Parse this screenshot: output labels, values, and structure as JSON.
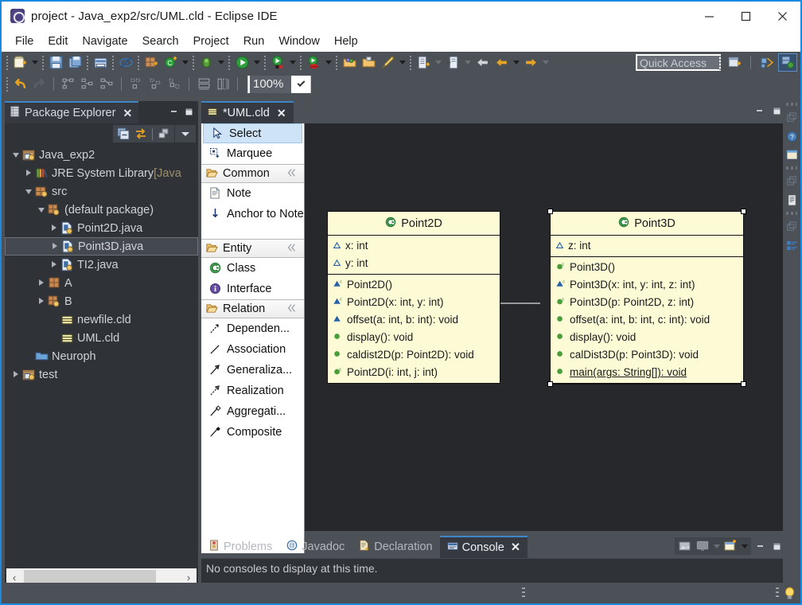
{
  "window": {
    "title": "project - Java_exp2/src/UML.cld - Eclipse IDE",
    "app_icon": "eclipse-icon",
    "minimize_label": "—",
    "maximize_label": "□",
    "close_label": "✕"
  },
  "menubar": {
    "items": [
      {
        "label": "File"
      },
      {
        "label": "Edit"
      },
      {
        "label": "Navigate"
      },
      {
        "label": "Search"
      },
      {
        "label": "Project"
      },
      {
        "label": "Run"
      },
      {
        "label": "Window"
      },
      {
        "label": "Help"
      }
    ]
  },
  "toolbar": {
    "zoom_value": "100%",
    "quick_access_placeholder": "Quick Access",
    "row1_icons": [
      "new-wizard-icon",
      "new-dropdown-arrow",
      "save-icon",
      "save-all-icon",
      "print-icon",
      "toggle-mark-occurrences-icon",
      "new-java-package-icon",
      "new-java-class-icon",
      "new-java-class-dropdown-arrow",
      "debug-icon",
      "debug-dropdown-arrow",
      "run-icon",
      "run-dropdown-arrow",
      "run-coverage-icon",
      "coverage-dropdown-arrow",
      "run-ant-icon",
      "ant-dropdown-arrow",
      "open-type-icon",
      "open-task-icon",
      "annotation-icon",
      "annotation-dropdown-arrow",
      "next-annotation-icon",
      "next-annotation-dropdown-arrow",
      "previous-edit-icon",
      "previous-edit-dropdown-arrow",
      "back-icon",
      "forward-orange-icon",
      "forward-dropdown-arrow",
      "next-icon",
      "next-dropdown-arrow"
    ],
    "row2_icons": [
      "undo-icon",
      "redo-icon",
      "align-left-icon",
      "align-center-icon",
      "align-right-icon",
      "align-top-icon",
      "align-middle-icon",
      "align-bottom-icon",
      "match-width-icon",
      "match-height-icon"
    ],
    "perspective_icons": [
      "open-perspective-icon",
      "java-perspective-icon",
      "uml-perspective-icon"
    ]
  },
  "package_explorer": {
    "tab_label": "Package Explorer",
    "tab_close": "✕",
    "tab_icon": "package-explorer-icon",
    "view_minimize": "—",
    "view_maximize": "■",
    "toolbar_icons": [
      "collapse-all-icon",
      "link-with-editor-icon",
      "focus-on-active-task-icon",
      "view-menu-icon"
    ],
    "tree": [
      {
        "label": "Java_exp2",
        "indent": 0,
        "twisty": "down",
        "icon": "java-project-icon",
        "selected": false
      },
      {
        "label": "JRE System Library",
        "indent": 1,
        "twisty": "right",
        "icon": "library-icon",
        "selected": false,
        "suffix": " [Java"
      },
      {
        "label": "src",
        "indent": 1,
        "twisty": "down",
        "icon": "source-folder-icon",
        "selected": false
      },
      {
        "label": "(default package)",
        "indent": 2,
        "twisty": "down",
        "icon": "package-icon",
        "selected": false
      },
      {
        "label": "Point2D.java",
        "indent": 3,
        "twisty": "right",
        "icon": "java-file-icon",
        "selected": false
      },
      {
        "label": "Point3D.java",
        "indent": 3,
        "twisty": "right",
        "icon": "java-file-icon",
        "selected": true
      },
      {
        "label": "TI2.java",
        "indent": 3,
        "twisty": "right",
        "icon": "java-file-icon",
        "selected": false
      },
      {
        "label": "A",
        "indent": 2,
        "twisty": "right",
        "icon": "package-plain-icon",
        "selected": false
      },
      {
        "label": "B",
        "indent": 2,
        "twisty": "right",
        "icon": "package-icon",
        "selected": false
      },
      {
        "label": "newfile.cld",
        "indent": 3,
        "twisty": "none",
        "icon": "cld-file-icon",
        "selected": false
      },
      {
        "label": "UML.cld",
        "indent": 3,
        "twisty": "none",
        "icon": "cld-file-icon",
        "selected": false
      },
      {
        "label": "Neuroph",
        "indent": 1,
        "twisty": "none",
        "icon": "folder-icon",
        "selected": false
      },
      {
        "label": "test",
        "indent": 0,
        "twisty": "right",
        "icon": "java-project-icon",
        "selected": false
      }
    ],
    "hscroll_left": "‹",
    "hscroll_right": "›"
  },
  "editor": {
    "tab_label": "*UML.cld",
    "tab_icon": "cld-file-icon",
    "tab_close": "✕",
    "minimize_label": "—",
    "maximize_label": "■"
  },
  "palette": {
    "tools": [
      {
        "label": "Select",
        "icon": "cursor-icon",
        "selected": true
      },
      {
        "label": "Marquee",
        "icon": "marquee-icon",
        "selected": false
      }
    ],
    "groups": [
      {
        "title": "Common",
        "icon": "folder-open-icon",
        "collapse_icon": "collapse-chevrons-icon",
        "items": [
          {
            "label": "Note",
            "icon": "note-icon",
            "two_line": false
          },
          {
            "label": "Anchor to Note",
            "icon": "anchor-arrow-icon",
            "two_line": true
          }
        ]
      },
      {
        "title": "Entity",
        "icon": "folder-open-icon",
        "collapse_icon": "collapse-chevrons-icon",
        "items": [
          {
            "label": "Class",
            "icon": "class-green-icon",
            "two_line": false
          },
          {
            "label": "Interface",
            "icon": "interface-purple-icon",
            "two_line": false
          }
        ]
      },
      {
        "title": "Relation",
        "icon": "folder-open-icon",
        "collapse_icon": "collapse-chevrons-icon",
        "items": [
          {
            "label": "Dependen...",
            "icon": "dependency-icon",
            "two_line": false
          },
          {
            "label": "Association",
            "icon": "association-icon",
            "two_line": false
          },
          {
            "label": "Generaliza...",
            "icon": "generalization-icon",
            "two_line": false
          },
          {
            "label": "Realization",
            "icon": "realization-icon",
            "two_line": false
          },
          {
            "label": "Aggregati...",
            "icon": "aggregation-icon",
            "two_line": false
          },
          {
            "label": "Composite",
            "icon": "composition-icon",
            "two_line": false
          }
        ]
      }
    ]
  },
  "diagram": {
    "classes": [
      {
        "name": "Point2D",
        "icon": "class-green-icon",
        "selected": false,
        "attributes": [
          {
            "text": "x: int",
            "icon": "protected-attr-icon",
            "static": false
          },
          {
            "text": "y: int",
            "icon": "protected-attr-icon",
            "static": false
          }
        ],
        "operations": [
          {
            "text": "Point2D()",
            "icon": "protected-ctor-icon",
            "static": false
          },
          {
            "text": "Point2D(x: int, y: int)",
            "icon": "protected-ctor-icon",
            "static": false
          },
          {
            "text": "offset(a: int, b: int): void",
            "icon": "protected-method-icon",
            "static": false
          },
          {
            "text": "display(): void",
            "icon": "public-method-icon",
            "static": false
          },
          {
            "text": "caldist2D(p: Point2D): void",
            "icon": "public-method-icon",
            "static": false
          },
          {
            "text": "Point2D(i: int, j: int)",
            "icon": "public-ctor-icon",
            "static": false
          }
        ]
      },
      {
        "name": "Point3D",
        "icon": "class-green-icon",
        "selected": true,
        "attributes": [
          {
            "text": "z: int",
            "icon": "protected-attr-icon",
            "static": false
          }
        ],
        "operations": [
          {
            "text": "Point3D()",
            "icon": "public-ctor-icon",
            "static": false
          },
          {
            "text": "Point3D(x: int, y: int, z: int)",
            "icon": "protected-ctor-icon",
            "static": false
          },
          {
            "text": "Point3D(p: Point2D, z: int)",
            "icon": "public-ctor-icon",
            "static": false
          },
          {
            "text": "offset(a: int, b: int, c: int): void",
            "icon": "public-method-icon",
            "static": false
          },
          {
            "text": "display(): void",
            "icon": "public-method-icon",
            "static": false
          },
          {
            "text": "calDist3D(p: Point3D): void",
            "icon": "public-method-icon",
            "static": false
          },
          {
            "text": "main(args: String[]): void",
            "icon": "public-method-icon",
            "static": true
          }
        ]
      }
    ],
    "relation": {
      "type": "generalization",
      "from": "Point3D",
      "to": "Point2D"
    }
  },
  "console": {
    "tabs": [
      {
        "label": "Problems",
        "icon": "problems-icon",
        "active": false
      },
      {
        "label": "Javadoc",
        "icon": "javadoc-icon",
        "active": false
      },
      {
        "label": "Declaration",
        "icon": "declaration-icon",
        "active": false
      },
      {
        "label": "Console",
        "icon": "console-icon",
        "active": true,
        "close": "✕"
      }
    ],
    "message": "No consoles to display at this time.",
    "toolbar_icons": [
      "clear-console-icon",
      "display-selected-console-icon",
      "display-console-dropdown-arrow",
      "open-console-icon",
      "open-console-dropdown-arrow"
    ],
    "minimize_label": "—",
    "maximize_label": "■"
  },
  "fastview": {
    "icons": [
      "outline-restore-icon",
      "help-icon",
      "properties-view-icon",
      "stack-separator",
      "restore-icon",
      "document-view-icon",
      "stack-separator2",
      "restore2-icon",
      "outline-list-icon"
    ]
  },
  "statusbar": {
    "tip_icon": "lightbulb-icon"
  },
  "colors": {
    "accent": "#1a8ae0",
    "window_chrome": "#4c5057",
    "panel_bg": "#2f3237",
    "tab_active": "#36393f",
    "uml_fill": "#fdfbd6",
    "palette_select": "#cfe3f7",
    "tree_select": "#44484f"
  }
}
